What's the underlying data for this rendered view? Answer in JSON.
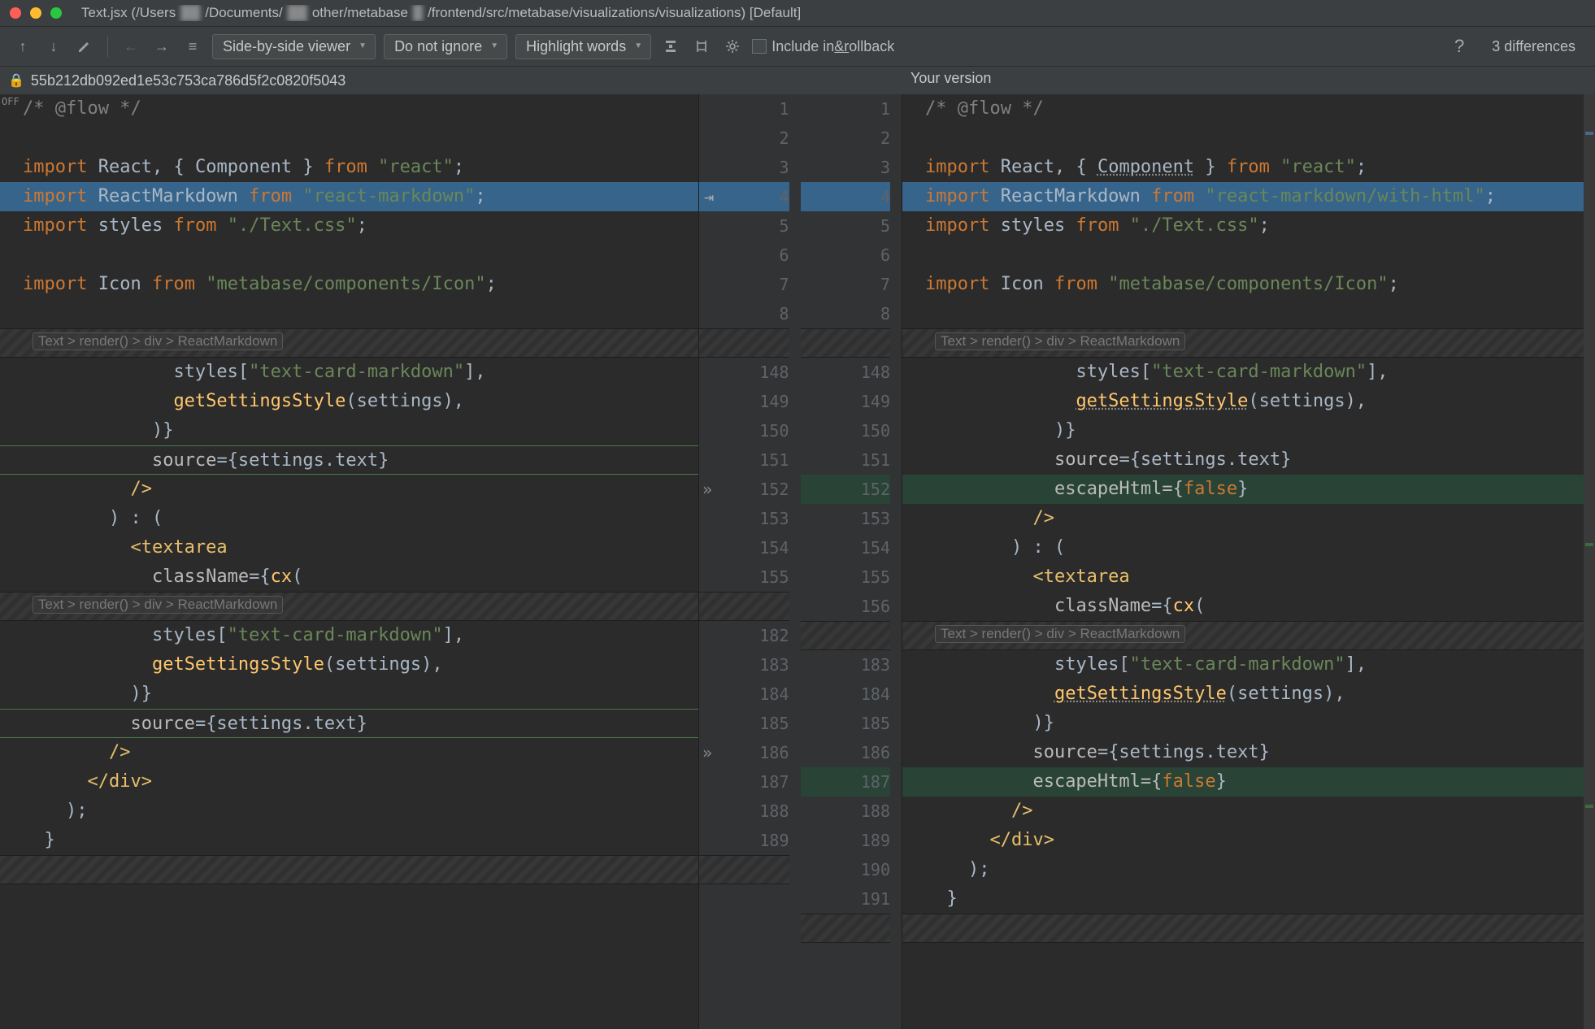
{
  "titlebar": {
    "filename": "Text.jsx",
    "path_prefix": "(/Users",
    "path_mid1": "/Documents/",
    "path_mid2": "other/metabase",
    "path_suffix": "/frontend/src/metabase/visualizations/visualizations) [Default]"
  },
  "toolbar": {
    "viewer_mode": "Side-by-side viewer",
    "ignore_mode": "Do not ignore",
    "highlight_mode": "Highlight words",
    "rollback_label_pre": "Include in ",
    "rollback_label_u": "&r",
    "rollback_label_post": "ollback",
    "diff_count": "3 differences"
  },
  "versions": {
    "left_label": "55b212db092ed1e53c753ca786d5f2c0820f5043",
    "right_label": "Your version"
  },
  "gutter": {
    "left": [
      "1",
      "2",
      "3",
      "4",
      "5",
      "6",
      "7",
      "8",
      "",
      "148",
      "149",
      "150",
      "151",
      "152",
      "153",
      "154",
      "155",
      "",
      "182",
      "183",
      "184",
      "185",
      "186",
      "187",
      "188",
      "189",
      "",
      "",
      "",
      ""
    ],
    "right": [
      "1",
      "2",
      "3",
      "4",
      "5",
      "6",
      "7",
      "8",
      "",
      "148",
      "149",
      "150",
      "151",
      "152",
      "153",
      "154",
      "155",
      "156",
      "",
      "183",
      "184",
      "185",
      "186",
      "187",
      "188",
      "189",
      "190",
      "191",
      "",
      ""
    ]
  },
  "breadcrumb": "Text > render() > div > ReactMarkdown",
  "code": {
    "flow_comment": "/* @flow */",
    "import_react": {
      "kw": "import",
      "a": "React",
      "b": "Component",
      "from": "from",
      "s": "\"react\""
    },
    "import_md_left": {
      "kw": "import",
      "a": "ReactMarkdown",
      "from": "from",
      "s": "\"react-markdown\""
    },
    "import_md_right": {
      "kw": "import",
      "a": "ReactMarkdown",
      "from": "from",
      "s": "\"react-markdown/with-html\""
    },
    "import_styles": {
      "kw": "import",
      "a": "styles",
      "from": "from",
      "s": "\"./Text.css\""
    },
    "import_icon": {
      "kw": "import",
      "a": "Icon",
      "from": "from",
      "s": "\"metabase/components/Icon\""
    },
    "styles_tcm": "styles[\"text-card-markdown\"],",
    "get_settings": "getSettingsStyle(settings),",
    "close_brace": ")}",
    "source_attr": "source={settings.text}",
    "escape_attr_pre": "escapeHtml={",
    "escape_attr_val": "false",
    "escape_attr_post": "}",
    "selfclose": "/>",
    "ternary": ") : (",
    "textarea_open": "<textarea",
    "classname_cx": "className={cx(",
    "div_close": "</div>",
    "paren_semi": ");",
    "brace": "}"
  }
}
